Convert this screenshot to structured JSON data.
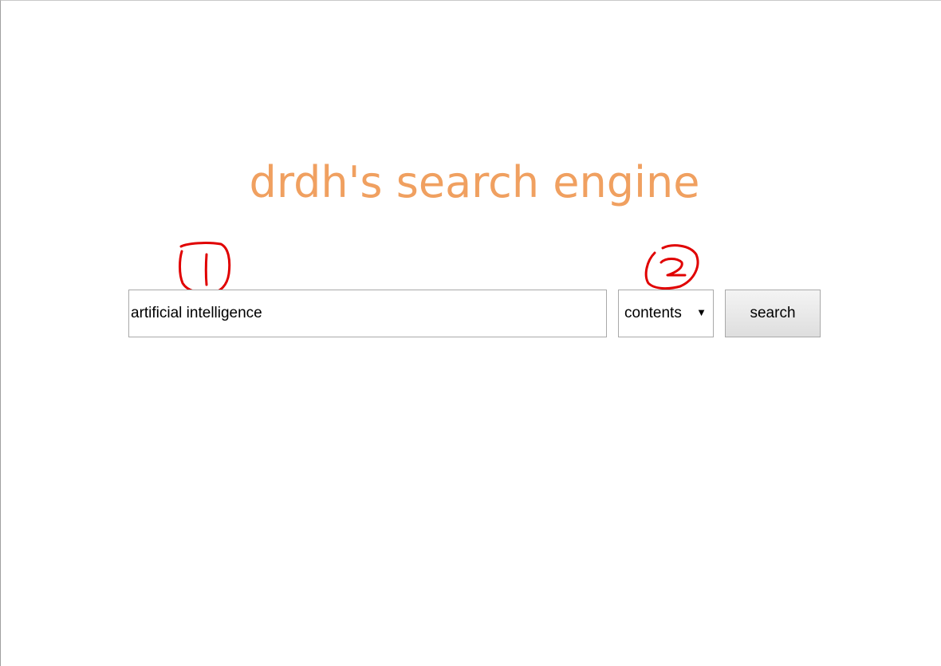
{
  "page": {
    "title": "drdh's search engine",
    "title_color": "#f0a060"
  },
  "search": {
    "query_value": "artificial intelligence",
    "field_value": "contents",
    "dropdown_arrow": "▼",
    "button_label": "search"
  },
  "annotations": {
    "color": "#e00000",
    "marker_1": "1",
    "marker_2": "2"
  }
}
